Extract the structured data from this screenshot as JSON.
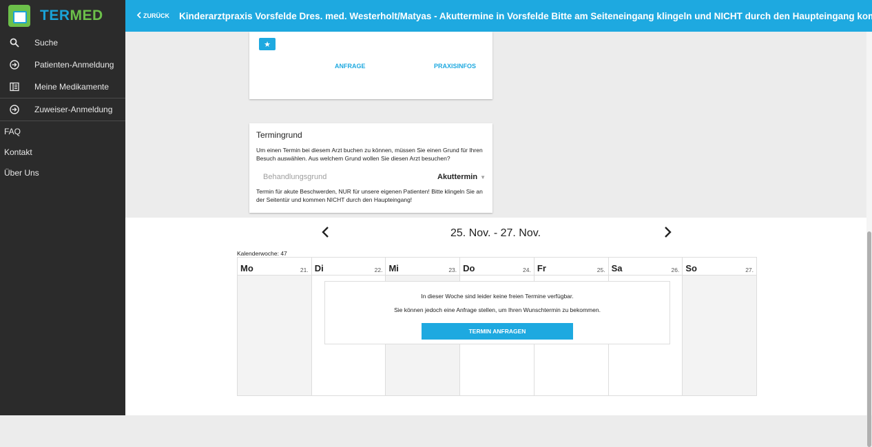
{
  "brand": {
    "name_part1": "TER",
    "name_part2": "MED"
  },
  "sidebar": {
    "items": [
      {
        "label": "Suche",
        "icon": "search-icon"
      },
      {
        "label": "Patienten-Anmeldung",
        "icon": "login-icon"
      },
      {
        "label": "Meine Medikamente",
        "icon": "medication-list-icon"
      },
      {
        "label": "Zuweiser-Anmeldung",
        "icon": "login-icon"
      }
    ],
    "links": [
      "FAQ",
      "Kontakt",
      "Über Uns"
    ]
  },
  "topbar": {
    "back_label": "ZURÜCK",
    "title": "Kinderarztpraxis Vorsfelde Dres. med. Westerholt/Matyas - Akuttermine in Vorsfelde Bitte am Seiteneingang klingeln und NICHT durch den Haupteingang kommen!",
    "color": "#1ea9e0"
  },
  "practice_card": {
    "anfrage_label": "ANFRAGE",
    "praxisinfos_label": "PRAXISINFOS"
  },
  "reason_card": {
    "heading": "Termingrund",
    "intro": "Um einen Termin bei diesem Arzt buchen zu können, müssen Sie einen Grund für Ihren Besuch auswählen. Aus welchem Grund wollen Sie diesen Arzt besuchen?",
    "field_label": "Behandlungsgrund",
    "selected_value": "Akuttermin",
    "note": "Termin für akute Beschwerden, NUR für unsere eigenen Patienten! Bitte klingeln Sie an der Seitentür und kommen NICHT durch den Haupteingang!"
  },
  "calendar": {
    "range": "25. Nov. - 27. Nov.",
    "week_label": "Kalenderwoche: 47",
    "days": [
      {
        "name": "Mo",
        "date": "21."
      },
      {
        "name": "Di",
        "date": "22."
      },
      {
        "name": "Mi",
        "date": "23."
      },
      {
        "name": "Do",
        "date": "24."
      },
      {
        "name": "Fr",
        "date": "25."
      },
      {
        "name": "Sa",
        "date": "26."
      },
      {
        "name": "So",
        "date": "27."
      }
    ],
    "notice_line1": "In dieser Woche sind leider keine freien Termine verfügbar.",
    "notice_line2": "Sie können jedoch eine Anfrage stellen, um Ihren Wunschtermin zu bekommen.",
    "request_button": "TERMIN ANFRAGEN"
  }
}
